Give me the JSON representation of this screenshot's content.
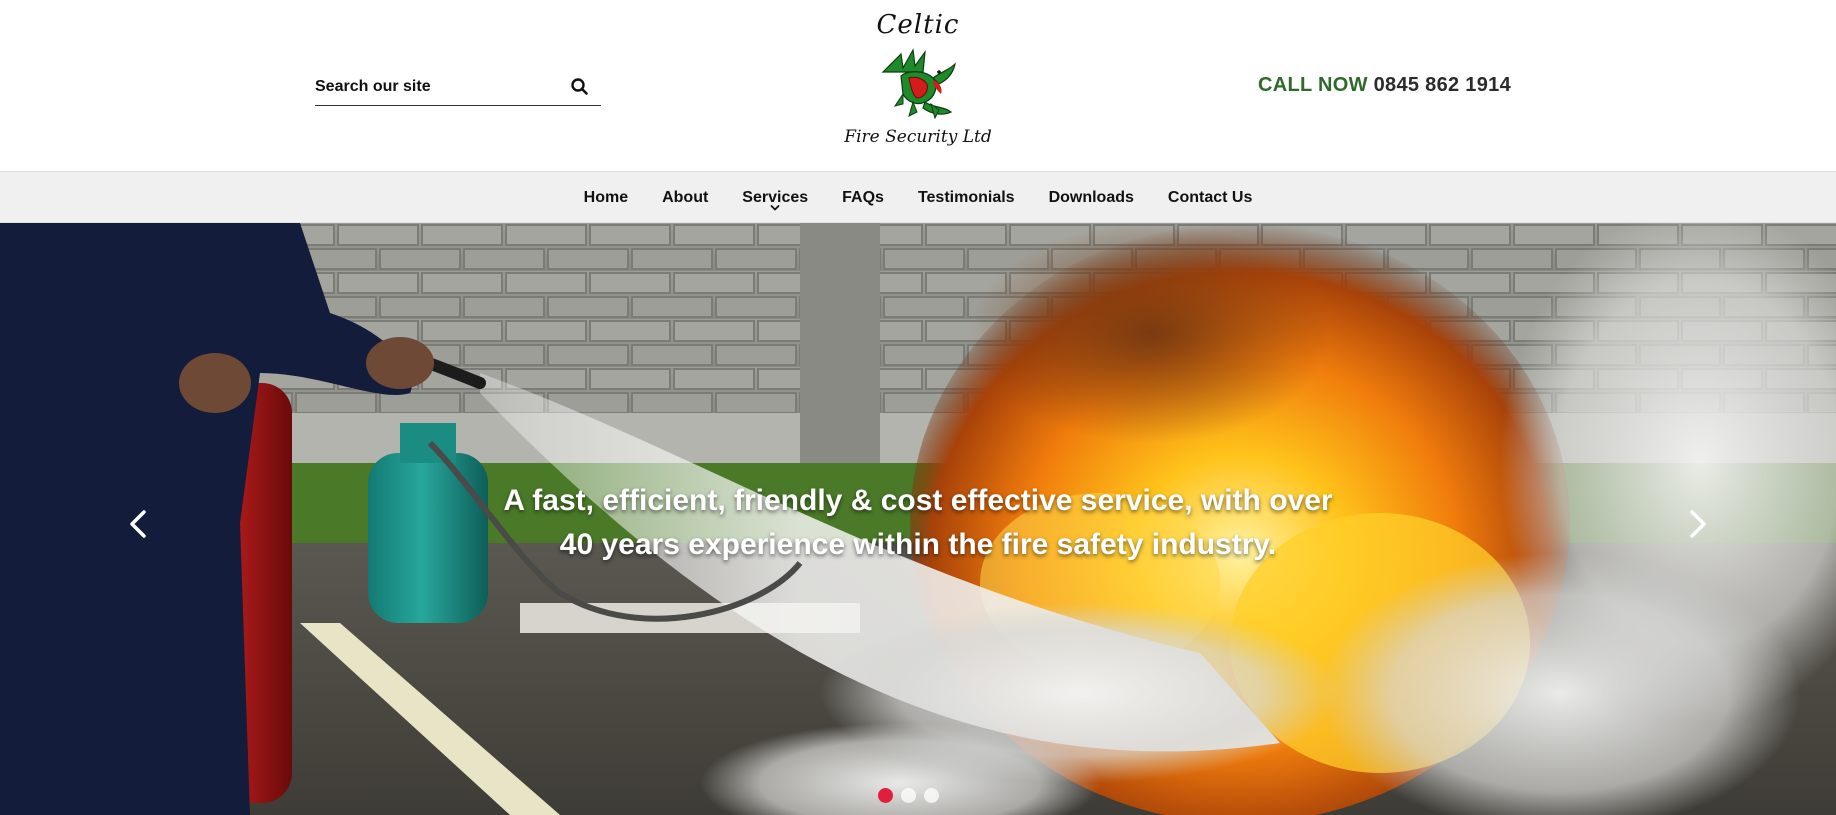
{
  "header": {
    "search": {
      "placeholder": "Search our site",
      "value": ""
    },
    "logo": {
      "top_text": "Celtic",
      "bottom_text": "Fire Security Ltd"
    },
    "phone": {
      "label": "CALL NOW",
      "number": "0845 862 1914"
    }
  },
  "colors": {
    "phone_label": "#2e6b2a",
    "active_dot": "#e0203a",
    "nav_background": "#f0f0f0"
  },
  "nav": {
    "items": [
      {
        "label": "Home"
      },
      {
        "label": "About"
      },
      {
        "label": "Services",
        "icon": "chevron-down-icon"
      },
      {
        "label": "FAQs"
      },
      {
        "label": "Testimonials"
      },
      {
        "label": "Downloads"
      },
      {
        "label": "Contact Us"
      }
    ]
  },
  "hero": {
    "caption_line1": "A fast, efficient, friendly & cost effective service, with over",
    "caption_line2": "40 years experience within the fire safety industry.",
    "slide_count": 3,
    "active_slide": 1
  }
}
